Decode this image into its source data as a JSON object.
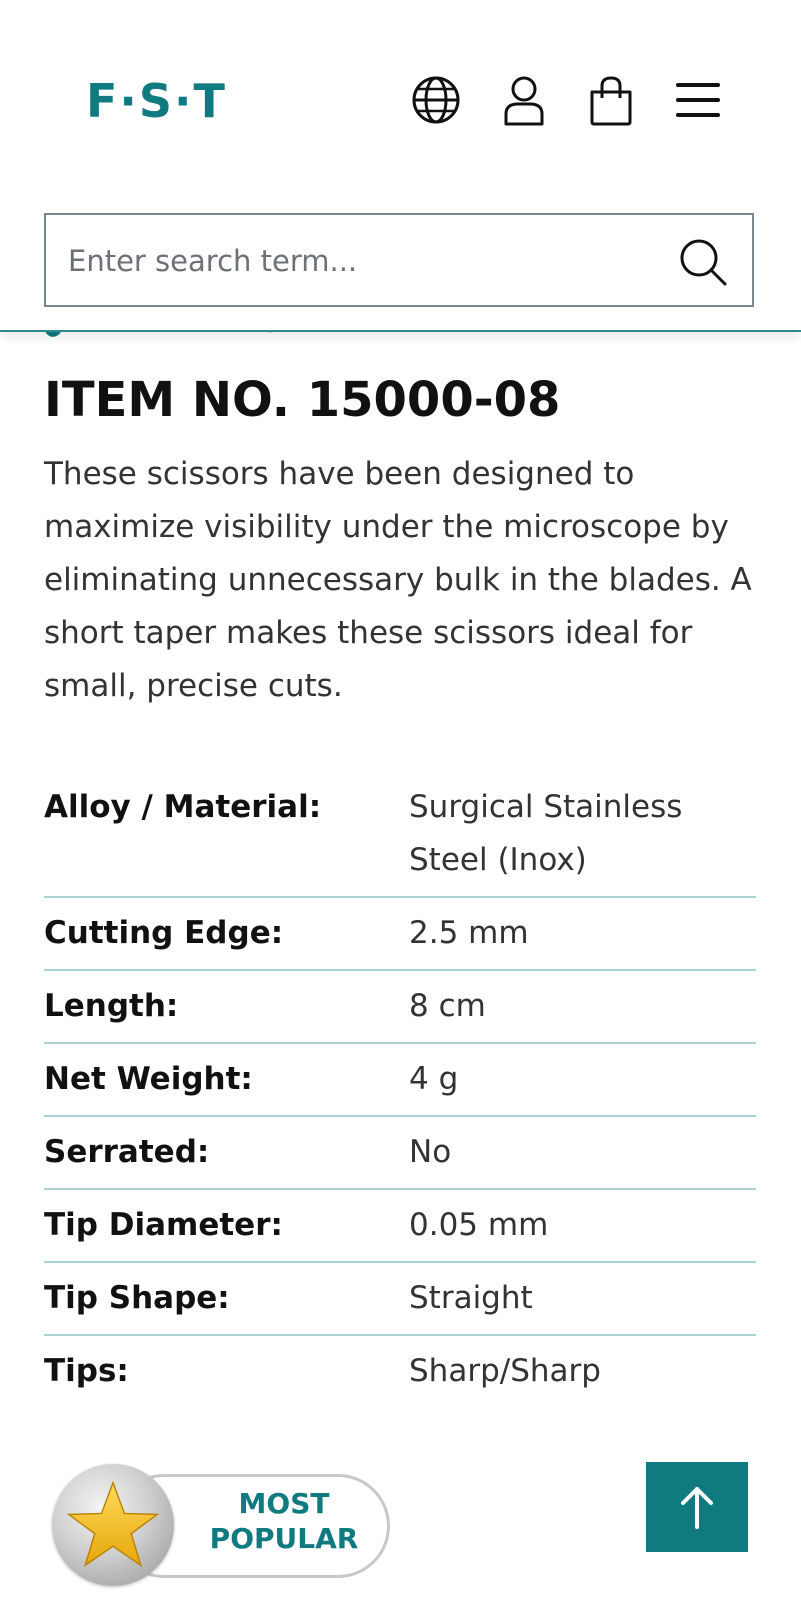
{
  "header": {
    "logo_text": "F·S·T",
    "icons": [
      "globe-icon",
      "user-icon",
      "shopping-bag-icon",
      "menu-icon"
    ],
    "brand_color": "#0f7a80"
  },
  "search": {
    "placeholder": "Enter search term...",
    "value": ""
  },
  "product": {
    "title": "ITEM NO. 15000-08",
    "description": "These scissors have been designed to maximize visibility under the microscope by eliminating unnecessary bulk in the blades. A short taper makes these scissors ideal for small, precise cuts."
  },
  "specs": [
    {
      "label": "Alloy / Material:",
      "value": "Surgical Stainless Steel (Inox)"
    },
    {
      "label": "Cutting Edge:",
      "value": "2.5 mm"
    },
    {
      "label": "Length:",
      "value": "8 cm"
    },
    {
      "label": "Net Weight:",
      "value": "4 g"
    },
    {
      "label": "Serrated:",
      "value": "No"
    },
    {
      "label": "Tip Diameter:",
      "value": "0.05 mm"
    },
    {
      "label": "Tip Shape:",
      "value": "Straight"
    },
    {
      "label": "Tips:",
      "value": "Sharp/Sharp"
    }
  ],
  "badge": {
    "line1": "MOST",
    "line2": "POPULAR",
    "icon": "star-icon"
  },
  "scroll_top": {
    "icon": "arrow-up-icon"
  }
}
